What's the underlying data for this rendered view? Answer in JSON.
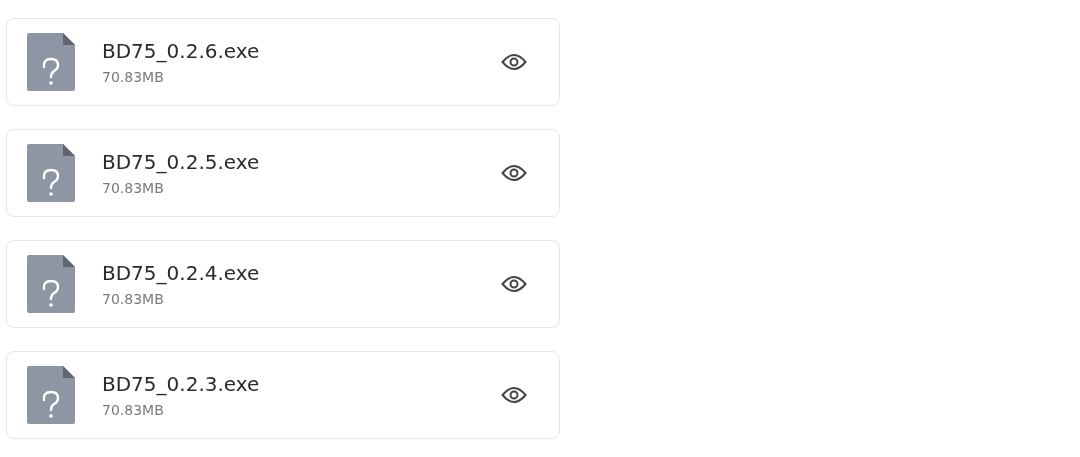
{
  "files": [
    {
      "name": "BD75_0.2.6.exe",
      "size": "70.83MB"
    },
    {
      "name": "BD75_0.2.5.exe",
      "size": "70.83MB"
    },
    {
      "name": "BD75_0.2.4.exe",
      "size": "70.83MB"
    },
    {
      "name": "BD75_0.2.3.exe",
      "size": "70.83MB"
    }
  ]
}
